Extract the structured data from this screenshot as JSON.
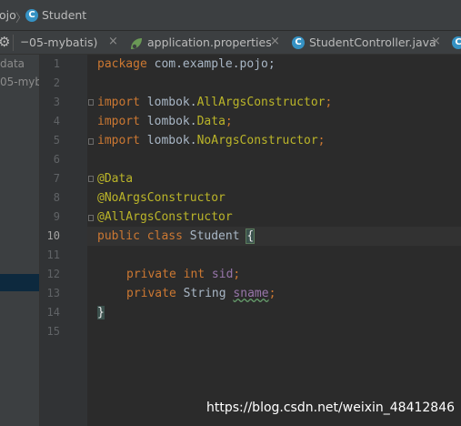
{
  "breadcrumb": {
    "part1": "ojo",
    "separator": "〉",
    "class_icon": "C",
    "part2": "Student"
  },
  "tabs": [
    {
      "label": "05-mybatis)",
      "close": "×",
      "icon": ""
    },
    {
      "label": "application.properties",
      "close": "×",
      "icon": "spring-leaf-icon"
    },
    {
      "label": "StudentController.java",
      "close": "×",
      "icon": "class-icon"
    }
  ],
  "tab_icon_glyph": "C",
  "project_tree": {
    "item1": "data",
    "item2": "05-myba"
  },
  "editor": {
    "current_line": 10,
    "line_numbers": [
      "1",
      "2",
      "3",
      "4",
      "5",
      "6",
      "7",
      "8",
      "9",
      "10",
      "11",
      "12",
      "13",
      "14",
      "15"
    ],
    "lines": {
      "l1_kw": "package",
      "l1_rest": " com.example.pojo;",
      "l3_kw": "import",
      "l3_pkg": " lombok.",
      "l3_cls": "AllArgsConstructor",
      "l3_end": ";",
      "l4_kw": "import",
      "l4_pkg": " lombok.",
      "l4_cls": "Data",
      "l4_end": ";",
      "l5_kw": "import",
      "l5_pkg": " lombok.",
      "l5_cls": "NoArgsConstructor",
      "l5_end": ";",
      "l7": "@Data",
      "l8": "@NoArgsConstructor",
      "l9": "@AllArgsConstructor",
      "l10_kw": "public class",
      "l10_name": " Student ",
      "l10_brace": "{",
      "l12_kw": "private int",
      "l12_field": "sid",
      "l12_end": ";",
      "l13_kw": "private",
      "l13_type": " String ",
      "l13_field": "sname",
      "l13_end": ";",
      "l14": "}"
    }
  },
  "watermark": "https://blog.csdn.net/weixin_48412846",
  "colors": {
    "keyword": "#cc7832",
    "annotation": "#bbb529",
    "field": "#9876aa",
    "text": "#a9b7c6",
    "class_badge": "#3592c4"
  }
}
